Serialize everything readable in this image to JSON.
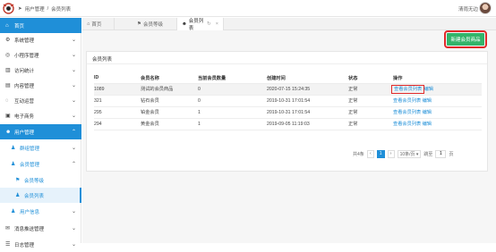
{
  "topbar": {
    "crumb_parent": "用户管理",
    "crumb_sep": "/",
    "crumb_current": "会员列表",
    "user_name": "清雨无边"
  },
  "sidebar": {
    "items": [
      {
        "label": "首页",
        "icon": "home-icon"
      },
      {
        "label": "系统管理",
        "icon": "gear-icon"
      },
      {
        "label": "小程序管理",
        "icon": "miniapp-icon"
      },
      {
        "label": "访问统计",
        "icon": "stats-icon"
      },
      {
        "label": "内容管理",
        "icon": "content-icon"
      },
      {
        "label": "互动运营",
        "icon": "interact-icon"
      },
      {
        "label": "电子商务",
        "icon": "shop-icon"
      },
      {
        "label": "用户管理",
        "icon": "users-icon"
      },
      {
        "label": "群组管理",
        "icon": "group-icon"
      },
      {
        "label": "会员管理",
        "icon": "member-icon"
      },
      {
        "label": "会员等级",
        "icon": "level-icon"
      },
      {
        "label": "会员列表",
        "icon": "list-icon"
      },
      {
        "label": "用户信息",
        "icon": "userinfo-icon"
      },
      {
        "label": "消息推送管理",
        "icon": "message-icon"
      },
      {
        "label": "日志管理",
        "icon": "log-icon"
      }
    ]
  },
  "tabs": [
    {
      "label": "首页"
    },
    {
      "label": "会员等级"
    },
    {
      "label": "会员列表"
    }
  ],
  "toolbar": {
    "new_button": "新建会员商品"
  },
  "panel": {
    "title": "会员列表"
  },
  "table": {
    "headers": [
      "ID",
      "会员名称",
      "当前会员数量",
      "创建时间",
      "状态",
      "操作"
    ],
    "rows": [
      {
        "id": "1089",
        "name": "测试的会员商品",
        "count": "0",
        "created": "2020-07-15 15:24:35",
        "status": "正常",
        "view": "查看会员列表",
        "edit": "编辑"
      },
      {
        "id": "321",
        "name": "钻石会员",
        "count": "0",
        "created": "2019-10-31 17:01:54",
        "status": "正常",
        "view": "查看会员列表",
        "edit": "编辑"
      },
      {
        "id": "295",
        "name": "铂金会员",
        "count": "1",
        "created": "2019-10-31 17:01:54",
        "status": "正常",
        "view": "查看会员列表",
        "edit": "编辑"
      },
      {
        "id": "294",
        "name": "黄金会员",
        "count": "1",
        "created": "2019-09-05 11:19:03",
        "status": "正常",
        "view": "查看会员列表",
        "edit": "编辑"
      }
    ]
  },
  "pager": {
    "total": "共4条",
    "prev": "‹",
    "page": "1",
    "next": "›",
    "page_size": "10条/页 ▾",
    "goto_label": "跳至",
    "goto_value": "1",
    "page_unit": "页"
  },
  "colors": {
    "accent": "#1f8fd8",
    "button": "#33b46a",
    "highlight": "#e02a2a"
  }
}
